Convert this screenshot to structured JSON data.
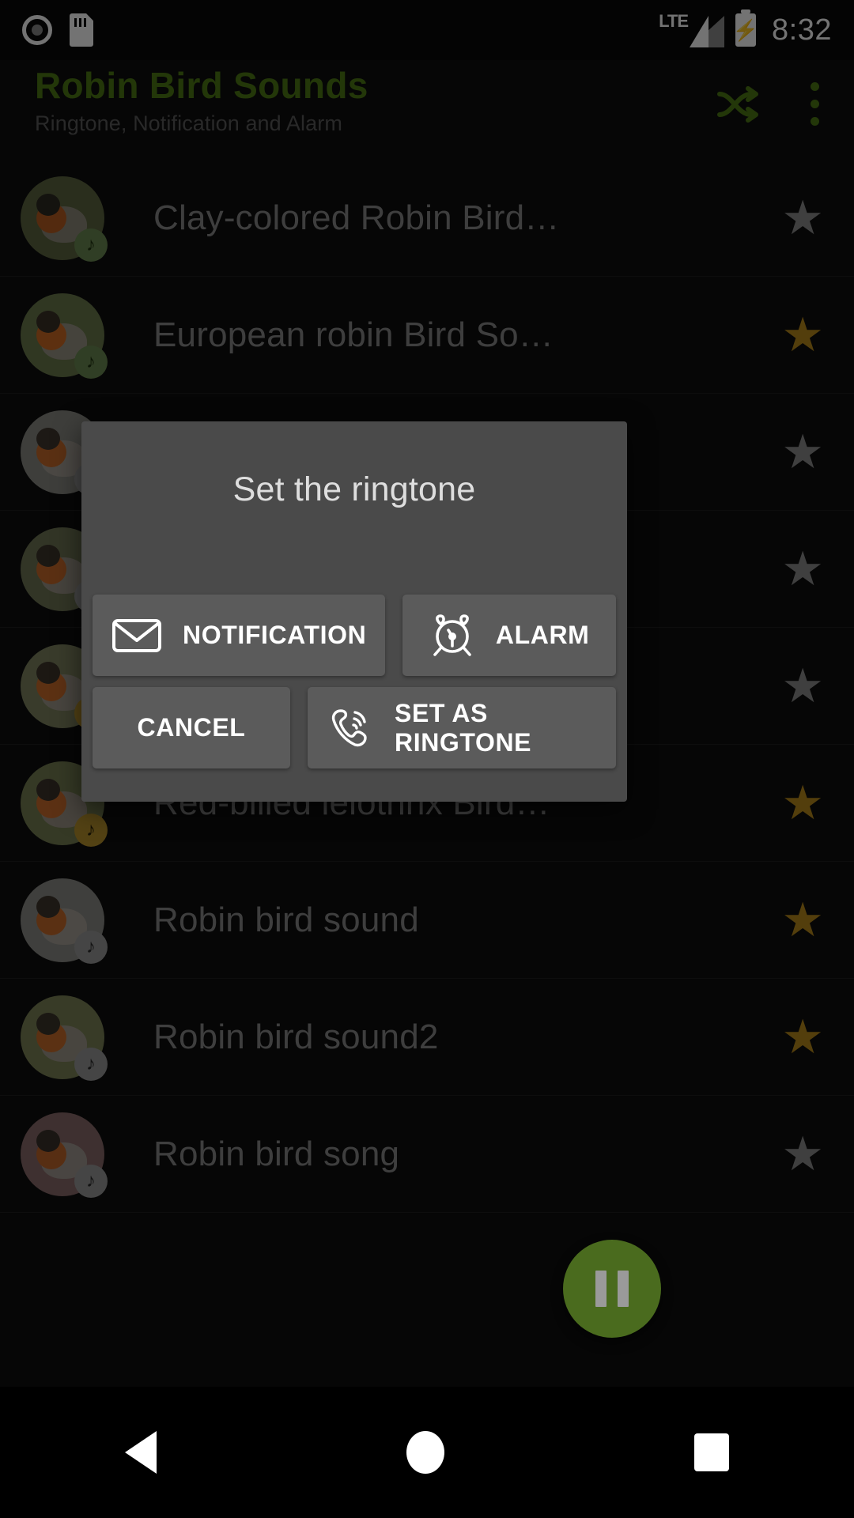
{
  "status_bar": {
    "icons": [
      "record-icon",
      "sd-card-icon"
    ],
    "network_type": "LTE",
    "signal_icon": "signal-bars-icon",
    "battery_icon": "battery-charging-icon",
    "time": "8:32"
  },
  "app_bar": {
    "title": "Robin Bird Sounds",
    "subtitle": "Ringtone, Notification and Alarm",
    "title_color": "#4f7a15",
    "shuffle_icon": "shuffle-icon",
    "overflow_icon": "more-vertical-icon"
  },
  "list": {
    "items": [
      {
        "title": "Clay-colored Robin Bird…",
        "favorite": false,
        "badge": "music-note-icon",
        "badge_color": "green",
        "avatar": {
          "bg": "#5d6640",
          "body": "#8f8a7a",
          "breast": "#b85d22",
          "head": "#2e2a22"
        }
      },
      {
        "title": "European robin Bird So…",
        "favorite": true,
        "badge": "music-note-icon",
        "badge_color": "green",
        "avatar": {
          "bg": "#6b7a4c",
          "body": "#9a9486",
          "breast": "#cf6b24",
          "head": "#3a3227"
        }
      },
      {
        "title": "",
        "favorite": false,
        "badge": "music-note-icon",
        "badge_color": "gray",
        "avatar": {
          "bg": "#8a8a84",
          "body": "#a6a098",
          "breast": "#c76a2a",
          "head": "#403830"
        }
      },
      {
        "title": "",
        "favorite": false,
        "badge": "music-note-icon",
        "badge_color": "gray",
        "avatar": {
          "bg": "#6f7656",
          "body": "#9b9488",
          "breast": "#c96c2c",
          "head": "#3d352b"
        }
      },
      {
        "title": "",
        "favorite": false,
        "badge": "music-note-icon",
        "badge_color": "gold",
        "avatar": {
          "bg": "#7e8460",
          "body": "#a09a8c",
          "breast": "#cc6d2b",
          "head": "#3e362c"
        }
      },
      {
        "title": "Red-billed leiothrix Bird…",
        "favorite": true,
        "badge": "music-note-icon",
        "badge_color": "gold",
        "avatar": {
          "bg": "#767e52",
          "body": "#9d9688",
          "breast": "#cd6e2d",
          "head": "#3c342a"
        }
      },
      {
        "title": "Robin bird sound",
        "favorite": true,
        "badge": "music-note-icon",
        "badge_color": "gray",
        "avatar": {
          "bg": "#8d8d88",
          "body": "#a8a29a",
          "breast": "#c86b2b",
          "head": "#3f372d"
        }
      },
      {
        "title": "Robin bird sound2",
        "favorite": true,
        "badge": "music-note-icon",
        "badge_color": "gray",
        "avatar": {
          "bg": "#7d8458",
          "body": "#a09a8c",
          "breast": "#cb6d2c",
          "head": "#3d352b"
        }
      },
      {
        "title": "Robin bird song",
        "favorite": false,
        "badge": "music-note-icon",
        "badge_color": "gray",
        "avatar": {
          "bg": "#8a6a6a",
          "body": "#a39a92",
          "breast": "#c2662a",
          "head": "#3a322a"
        }
      }
    ],
    "star_on_color": "#b8891c",
    "star_off_color": "#8c8c8c",
    "star_glyph": "★"
  },
  "dialog": {
    "title": "Set the ringtone",
    "buttons": {
      "notification": {
        "label": "NOTIFICATION",
        "icon": "envelope-icon"
      },
      "alarm": {
        "label": "ALARM",
        "icon": "alarm-clock-icon"
      },
      "cancel": {
        "label": "CANCEL"
      },
      "set_as_ringtone": {
        "label": "SET AS RINGTONE",
        "icon": "ringing-phone-icon"
      }
    },
    "background_color": "#4a4a4a",
    "button_color": "#5b5b5b"
  },
  "player_fab": {
    "icon": "pause-icon",
    "color": "#4a6b1e"
  },
  "nav_bar": {
    "back": "back-triangle-icon",
    "home": "home-circle-icon",
    "recents": "recents-square-icon"
  }
}
